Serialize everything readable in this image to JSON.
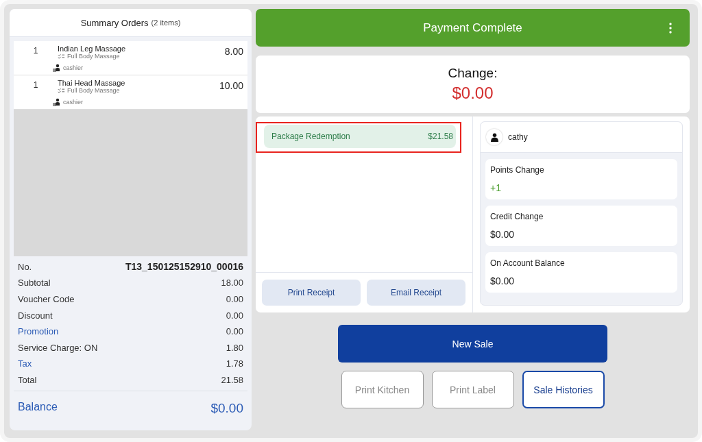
{
  "summary": {
    "title": "Summary Orders",
    "count": "(2 items)",
    "items": [
      {
        "qty": "1",
        "name": "Indian Leg Massage",
        "category": "Full Body Massage",
        "staff": "cashier",
        "price": "8.00"
      },
      {
        "qty": "1",
        "name": "Thai Head Massage",
        "category": "Full Body Massage",
        "staff": "cashier",
        "price": "10.00"
      }
    ],
    "lines": [
      {
        "label": "No.",
        "value": "T13_150125152910_00016",
        "kind": "strong"
      },
      {
        "label": "Subtotal",
        "value": "18.00",
        "kind": "plain"
      },
      {
        "label": "Voucher Code",
        "value": "0.00",
        "kind": "plain"
      },
      {
        "label": "Discount",
        "value": "0.00",
        "kind": "plain"
      },
      {
        "label": "Promotion",
        "value": "0.00",
        "kind": "link"
      },
      {
        "label": "Service Charge: ON",
        "value": "1.80",
        "kind": "plain"
      },
      {
        "label": "Tax",
        "value": "1.78",
        "kind": "link"
      },
      {
        "label": "Total",
        "value": "21.58",
        "kind": "plain"
      }
    ],
    "balance": {
      "label": "Balance",
      "value": "$0.00"
    }
  },
  "header": {
    "title": "Payment Complete"
  },
  "change": {
    "label": "Change:",
    "value": "$0.00"
  },
  "payments": [
    {
      "name": "Package Redemption",
      "amount": "$21.58",
      "highlighted": true
    }
  ],
  "receipt_buttons": [
    "Print Receipt",
    "Email Receipt"
  ],
  "customer": {
    "name": "cathy",
    "stats": [
      {
        "label": "Points Change",
        "value": "+1",
        "kind": "positive"
      },
      {
        "label": "Credit Change",
        "value": "$0.00",
        "kind": "plain"
      },
      {
        "label": "On Account Balance",
        "value": "$0.00",
        "kind": "plain"
      }
    ]
  },
  "new_sale": "New Sale",
  "actions": [
    {
      "label": "Print Kitchen",
      "disabled": true
    },
    {
      "label": "Print Label",
      "disabled": true
    },
    {
      "label": "Sale Histories",
      "disabled": false
    }
  ]
}
